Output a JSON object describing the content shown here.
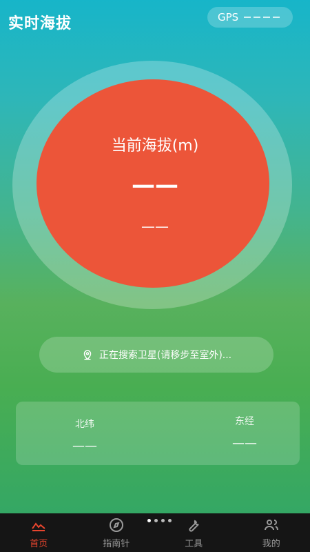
{
  "header": {
    "title": "实时海拔",
    "gps_label": "GPS"
  },
  "altitude": {
    "label": "当前海拔(m)",
    "value": "——",
    "secondary": "——"
  },
  "status": {
    "text": "正在搜索卫星(请移步至室外)..."
  },
  "coordinates": {
    "latitude_label": "北纬",
    "latitude_value": "——",
    "longitude_label": "东经",
    "longitude_value": "——"
  },
  "nav": {
    "items": [
      {
        "label": "首页",
        "icon": "mountain-icon",
        "active": true
      },
      {
        "label": "指南针",
        "icon": "compass-icon",
        "active": false
      },
      {
        "label": "工具",
        "icon": "wrench-icon",
        "active": false
      },
      {
        "label": "我的",
        "icon": "users-icon",
        "active": false
      }
    ]
  },
  "colors": {
    "accent": "#ec5539",
    "nav_active": "#e8452e",
    "nav_bg": "#151515"
  }
}
